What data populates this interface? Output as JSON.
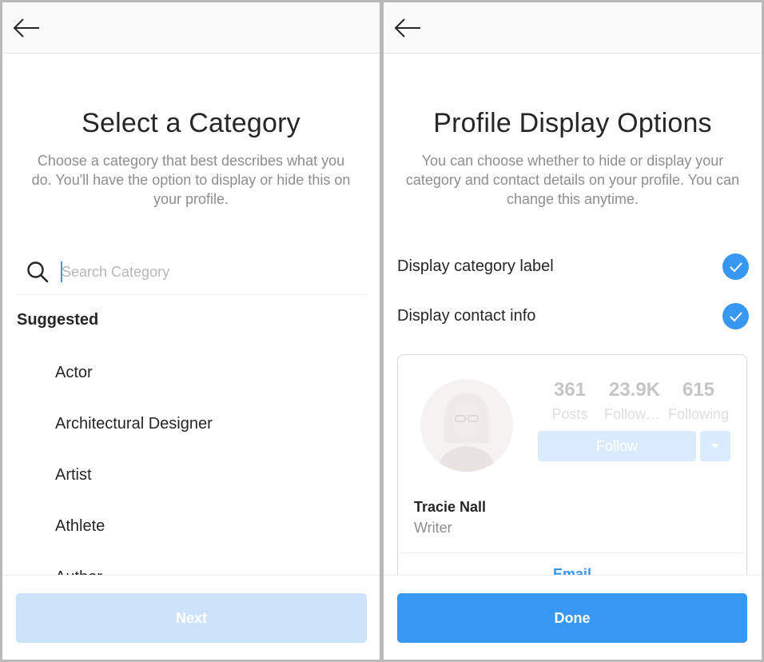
{
  "select_category": {
    "title": "Select a Category",
    "description": "Choose a category that best describes what you do. You'll have the option to display or hide this on your profile.",
    "search": {
      "placeholder": "Search Category",
      "value": ""
    },
    "suggested_label": "Suggested",
    "categories": [
      "Actor",
      "Architectural Designer",
      "Artist",
      "Athlete",
      "Author"
    ],
    "next_label": "Next"
  },
  "profile_display": {
    "title": "Profile Display Options",
    "description": "You can choose whether to hide or display your category and contact details on your profile. You can change this anytime.",
    "options": [
      {
        "label": "Display category label",
        "checked": true
      },
      {
        "label": "Display contact info",
        "checked": true
      }
    ],
    "preview": {
      "stats": [
        {
          "value": "361",
          "label": "Posts"
        },
        {
          "value": "23.9K",
          "label": "Followers"
        },
        {
          "value": "615",
          "label": "Following"
        }
      ],
      "follow_label": "Follow",
      "name": "Tracie Nall",
      "category": "Writer",
      "contact_link": "Email"
    },
    "done_label": "Done"
  },
  "icons": {
    "back": "arrow-left-icon",
    "search": "search-icon",
    "check": "checkmark-icon",
    "dropdown": "caret-down-icon"
  },
  "colors": {
    "accent": "#3897f0",
    "accent_disabled": "#cce3f9",
    "text_primary": "#262626",
    "text_secondary": "#8e8e8e"
  }
}
